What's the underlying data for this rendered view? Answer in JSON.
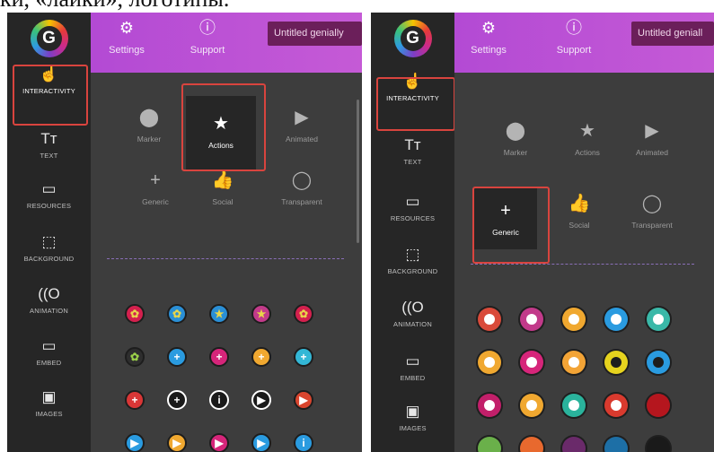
{
  "caption": "ки, «лайки», логотипы.",
  "logo_letter": "G",
  "sidebar": [
    {
      "key": "interactivity",
      "label": "INTERACTIVITY",
      "icon": "touch-icon"
    },
    {
      "key": "text",
      "label": "TEXT",
      "icon": "text-icon"
    },
    {
      "key": "resources",
      "label": "RESOURCES",
      "icon": "resources-icon"
    },
    {
      "key": "background",
      "label": "BACKGROUND",
      "icon": "background-icon"
    },
    {
      "key": "animation",
      "label": "ANIMATION",
      "icon": "animation-icon"
    },
    {
      "key": "embed",
      "label": "EMBED",
      "icon": "embed-icon"
    },
    {
      "key": "images",
      "label": "IMAGES",
      "icon": "images-icon"
    }
  ],
  "topbar": {
    "settings": "Settings",
    "support": "Support",
    "title_left": "Untitled genially",
    "title_right": "Untitled geniall"
  },
  "types": [
    {
      "key": "marker",
      "label": "Marker",
      "icon": "marker-pin-icon"
    },
    {
      "key": "actions",
      "label": "Actions",
      "icon": "star-icon"
    },
    {
      "key": "animated",
      "label": "Animated",
      "icon": "play-icon"
    },
    {
      "key": "generic",
      "label": "Generic",
      "icon": "plus-icon"
    },
    {
      "key": "social",
      "label": "Social",
      "icon": "thumbs-up-icon"
    },
    {
      "key": "transparent",
      "label": "Transparent",
      "icon": "circle-outline-icon"
    }
  ],
  "panels": [
    {
      "selected_sidebar": "interactivity",
      "selected_type": "actions"
    },
    {
      "selected_sidebar": "interactivity",
      "selected_type": "generic"
    }
  ],
  "left_grid": [
    [
      {
        "bg": "#d4204e",
        "fg": "#e8d64a",
        "g": "✿"
      },
      {
        "bg": "#2a8fd6",
        "fg": "#e8d64a",
        "g": "✿"
      },
      {
        "bg": "#2a8fd6",
        "fg": "#e8d64a",
        "g": "★"
      },
      {
        "bg": "#c23a8a",
        "fg": "#e8d64a",
        "g": "★"
      },
      {
        "bg": "#d4204e",
        "fg": "#e8d64a",
        "g": "✿"
      }
    ],
    [
      {
        "bg": "#2e2e2e",
        "fg": "#9bd14a",
        "g": "✿"
      },
      {
        "bg": "#2a9be0",
        "fg": "#ffffff",
        "g": "+"
      },
      {
        "bg": "#d6257a",
        "fg": "#ffffff",
        "g": "+"
      },
      {
        "bg": "#f0a830",
        "fg": "#ffffff",
        "g": "+"
      },
      {
        "bg": "#33b7d6",
        "fg": "#ffffff",
        "g": "+"
      }
    ],
    [
      {
        "bg": "#d93636",
        "fg": "#ffffff",
        "g": "+"
      },
      {
        "bg": "#1a1a1a",
        "fg": "#ffffff",
        "g": "+"
      },
      {
        "bg": "#1a1a1a",
        "fg": "#ffffff",
        "g": "i"
      },
      {
        "bg": "#1a1a1a",
        "fg": "#ffffff",
        "g": "▶"
      },
      {
        "bg": "#d9452e",
        "fg": "#ffffff",
        "g": "▶"
      }
    ],
    [
      {
        "bg": "#2a9be0",
        "fg": "#ffffff",
        "g": "▶"
      },
      {
        "bg": "#f0a830",
        "fg": "#ffffff",
        "g": "▶"
      },
      {
        "bg": "#d6257a",
        "fg": "#ffffff",
        "g": "▶"
      },
      {
        "bg": "#2a9be0",
        "fg": "#ffffff",
        "g": "▶"
      },
      {
        "bg": "#2a9be0",
        "fg": "#ffffff",
        "g": "i"
      }
    ]
  ],
  "right_grid": [
    [
      {
        "c": "#d94a3a",
        "s": "w"
      },
      {
        "c": "#c23a8a",
        "s": "w"
      },
      {
        "c": "#f0a830",
        "s": "w"
      },
      {
        "c": "#2a9be0",
        "s": "w"
      },
      {
        "c": "#3ab8a8",
        "s": "w"
      }
    ],
    [
      {
        "c": "#f0a830",
        "s": "w"
      },
      {
        "c": "#d6257a",
        "s": "w"
      },
      {
        "c": "#f3a436",
        "s": "w"
      },
      {
        "c": "#e6d31e",
        "s": "d"
      },
      {
        "c": "#2a9be0",
        "s": "d"
      }
    ],
    [
      {
        "c": "#c21f6a",
        "s": "w"
      },
      {
        "c": "#f0a830",
        "s": "w"
      },
      {
        "c": "#2ab39c",
        "s": "w"
      },
      {
        "c": "#d93a2e",
        "s": "w"
      },
      {
        "c": "#b5161e",
        "s": "n"
      }
    ],
    [
      {
        "c": "#6ab04a",
        "s": "n"
      },
      {
        "c": "#e8692e",
        "s": "n"
      },
      {
        "c": "#6a2a6a",
        "s": "n"
      },
      {
        "c": "#1d6fa6",
        "s": "n"
      },
      {
        "c": "#1a1a1a",
        "s": "n"
      }
    ]
  ]
}
